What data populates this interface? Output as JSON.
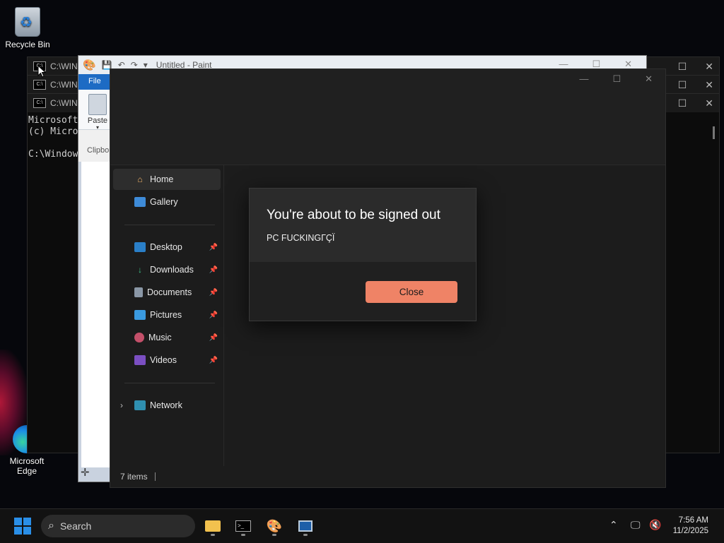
{
  "desktop": {
    "icons": [
      {
        "label": "Recycle Bin",
        "icon": "recycle-bin-icon"
      },
      {
        "label": "Microsoft Edge",
        "icon": "edge-icon"
      }
    ]
  },
  "cmd_windows": [
    {
      "title": "C:\\WIND"
    },
    {
      "title": "C:\\WIN"
    },
    {
      "title": "C:\\WIN"
    }
  ],
  "cmd_text": {
    "line1": "Microsoft",
    "line2": "(c) Micro",
    "line3": "",
    "line4": "C:\\Window"
  },
  "paint": {
    "title": "Untitled - Paint",
    "file_tab": "File",
    "paste_label": "Paste",
    "clipboard_group": "Clipbo"
  },
  "explorer": {
    "nav": {
      "home": "Home",
      "gallery": "Gallery",
      "desktop": "Desktop",
      "downloads": "Downloads",
      "documents": "Documents",
      "pictures": "Pictures",
      "music": "Music",
      "videos": "Videos",
      "network": "Network"
    },
    "status": "7 items"
  },
  "dialog": {
    "title": "You're about to be signed out",
    "message": "PC FUCKINGГÇЇ",
    "close_label": "Close",
    "accent": "#ef8366"
  },
  "taskbar": {
    "search_label": "Search",
    "time": "7:56 AM",
    "date": "11/2/2025",
    "start_color": "#2a8fe8"
  }
}
